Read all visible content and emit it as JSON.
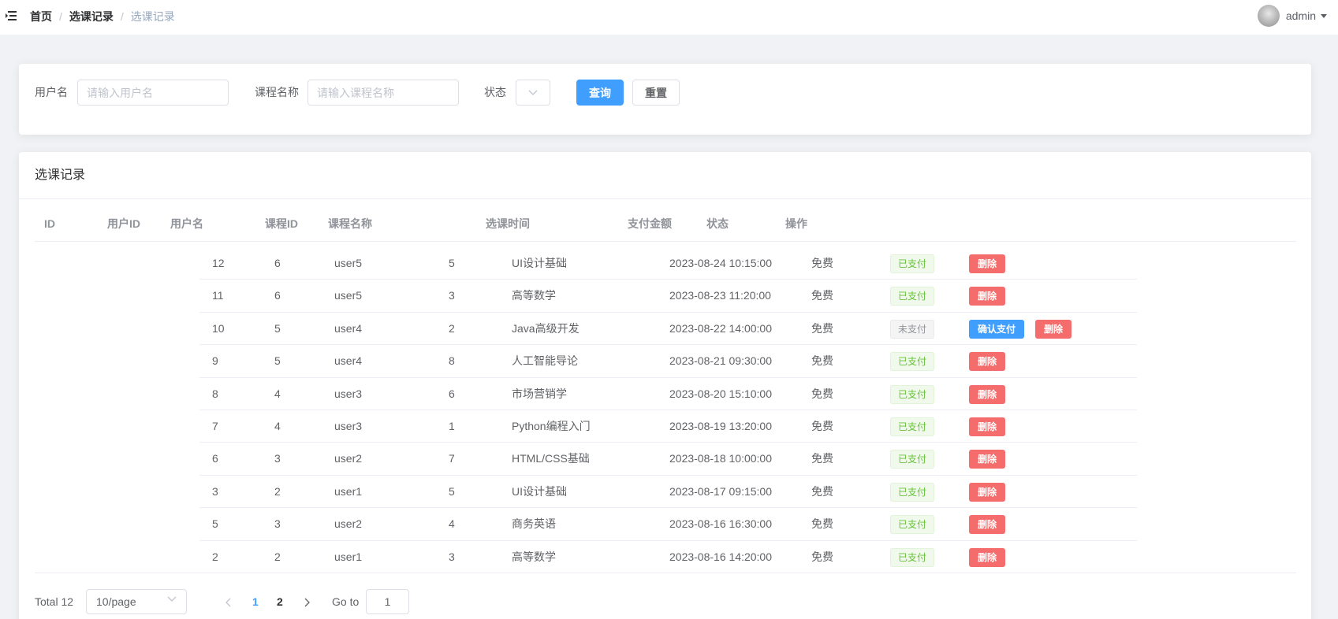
{
  "breadcrumb": {
    "home": "首页",
    "parent": "选课记录",
    "current": "选课记录",
    "separator": "/"
  },
  "user": {
    "name": "admin"
  },
  "search": {
    "username_label": "用户名",
    "username_placeholder": "请输入用户名",
    "course_label": "课程名称",
    "course_placeholder": "请输入课程名称",
    "status_label": "状态",
    "query_label": "查询",
    "reset_label": "重置"
  },
  "table_card": {
    "title": "选课记录",
    "headers": [
      "ID",
      "用户ID",
      "用户名",
      "课程ID",
      "课程名称",
      "选课时间",
      "支付金额",
      "状态",
      "操作"
    ],
    "rows": [
      {
        "id": "12",
        "user_id": "6",
        "username": "user5",
        "course_id": "5",
        "course_name": "UI设计基础",
        "time": "2023-08-24 10:15:00",
        "amount": "免费",
        "status": "已支付",
        "status_type": "success",
        "actions": [
          "删除"
        ]
      },
      {
        "id": "11",
        "user_id": "6",
        "username": "user5",
        "course_id": "3",
        "course_name": "高等数学",
        "time": "2023-08-23 11:20:00",
        "amount": "免费",
        "status": "已支付",
        "status_type": "success",
        "actions": [
          "删除"
        ]
      },
      {
        "id": "10",
        "user_id": "5",
        "username": "user4",
        "course_id": "2",
        "course_name": "Java高级开发",
        "time": "2023-08-22 14:00:00",
        "amount": "免费",
        "status": "未支付",
        "status_type": "info",
        "actions": [
          "确认支付",
          "删除"
        ]
      },
      {
        "id": "9",
        "user_id": "5",
        "username": "user4",
        "course_id": "8",
        "course_name": "人工智能导论",
        "time": "2023-08-21 09:30:00",
        "amount": "免费",
        "status": "已支付",
        "status_type": "success",
        "actions": [
          "删除"
        ]
      },
      {
        "id": "8",
        "user_id": "4",
        "username": "user3",
        "course_id": "6",
        "course_name": "市场营销学",
        "time": "2023-08-20 15:10:00",
        "amount": "免费",
        "status": "已支付",
        "status_type": "success",
        "actions": [
          "删除"
        ]
      },
      {
        "id": "7",
        "user_id": "4",
        "username": "user3",
        "course_id": "1",
        "course_name": "Python编程入门",
        "time": "2023-08-19 13:20:00",
        "amount": "免费",
        "status": "已支付",
        "status_type": "success",
        "actions": [
          "删除"
        ]
      },
      {
        "id": "6",
        "user_id": "3",
        "username": "user2",
        "course_id": "7",
        "course_name": "HTML/CSS基础",
        "time": "2023-08-18 10:00:00",
        "amount": "免费",
        "status": "已支付",
        "status_type": "success",
        "actions": [
          "删除"
        ]
      },
      {
        "id": "3",
        "user_id": "2",
        "username": "user1",
        "course_id": "5",
        "course_name": "UI设计基础",
        "time": "2023-08-17 09:15:00",
        "amount": "免费",
        "status": "已支付",
        "status_type": "success",
        "actions": [
          "删除"
        ]
      },
      {
        "id": "5",
        "user_id": "3",
        "username": "user2",
        "course_id": "4",
        "course_name": "商务英语",
        "time": "2023-08-16 16:30:00",
        "amount": "免费",
        "status": "已支付",
        "status_type": "success",
        "actions": [
          "删除"
        ]
      },
      {
        "id": "2",
        "user_id": "2",
        "username": "user1",
        "course_id": "3",
        "course_name": "高等数学",
        "time": "2023-08-16 14:20:00",
        "amount": "免费",
        "status": "已支付",
        "status_type": "success",
        "actions": [
          "删除"
        ]
      }
    ]
  },
  "pagination": {
    "total_label": "Total 12",
    "page_size": "10/page",
    "pages": [
      "1",
      "2"
    ],
    "current_page": "1",
    "goto_label": "Go to",
    "goto_value": "1",
    "prev_icon": "chevron-left-icon",
    "next_icon": "chevron-right-icon"
  },
  "colors": {
    "primary": "#409eff",
    "danger": "#f56c6c",
    "success": "#67c23a",
    "info": "#909399"
  }
}
